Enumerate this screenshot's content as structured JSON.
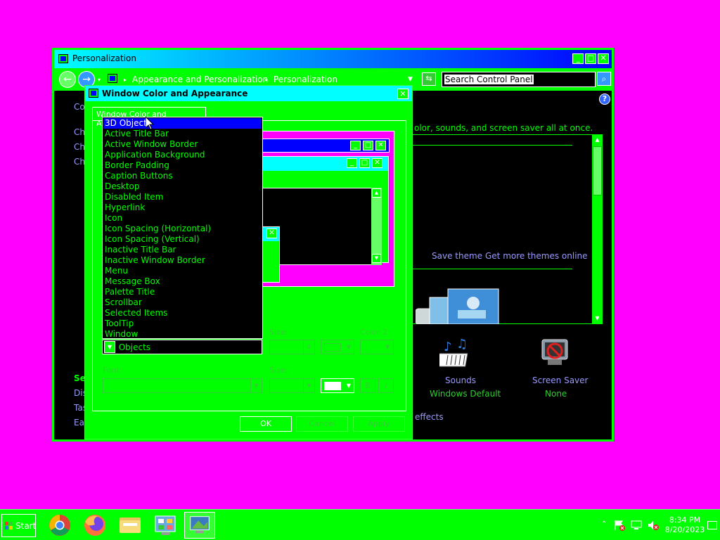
{
  "main_window": {
    "title": "Personalization",
    "breadcrumb": [
      "Appearance and Personalization",
      "Personalization"
    ],
    "search_placeholder": "Search Control Panel",
    "sidebar": {
      "top_item": "Co",
      "items": [
        "Ch",
        "Ch",
        "Ch"
      ],
      "see_also_heading": "Se",
      "see_also": [
        "Dis",
        "Tas",
        "Eas"
      ]
    },
    "intro_text": "olor, sounds, and screen saver all at once.",
    "save_theme": "Save theme",
    "get_more_themes": "Get more themes online",
    "sounds": {
      "label": "Sounds",
      "value": "Windows Default"
    },
    "screen_saver": {
      "label": "Screen Saver",
      "value": "None"
    },
    "effects_link": "effects"
  },
  "dialog": {
    "title": "Window Color and Appearance",
    "tab": "Window Color and Appearance",
    "item_list": [
      "3D Objects",
      "Active Title Bar",
      "Active Window Border",
      "Application Background",
      "Border Padding",
      "Caption Buttons",
      "Desktop",
      "Disabled Item",
      "Hyperlink",
      "Icon",
      "Icon Spacing (Horizontal)",
      "Icon Spacing (Vertical)",
      "Inactive Title Bar",
      "Inactive Window Border",
      "Menu",
      "Message Box",
      "Palette Title",
      "Scrollbar",
      "Selected Items",
      "ToolTip",
      "Window"
    ],
    "selected_item": "3D Objects",
    "size_label": "Size:",
    "color2_label": "Color 2:",
    "font_label": "Font:",
    "font_size_label": "Size:",
    "bold_label": "B",
    "italic_label": "I",
    "ok": "OK",
    "cancel": "Cancel",
    "apply": "Apply"
  },
  "taskbar": {
    "start": "Start",
    "time": "8:34 PM",
    "date": "8/20/2023"
  },
  "colors": {
    "desktop": "#ff00ff",
    "window_face": "#00ff00",
    "active_title": "#00ffff",
    "selection": "#0000ff"
  }
}
